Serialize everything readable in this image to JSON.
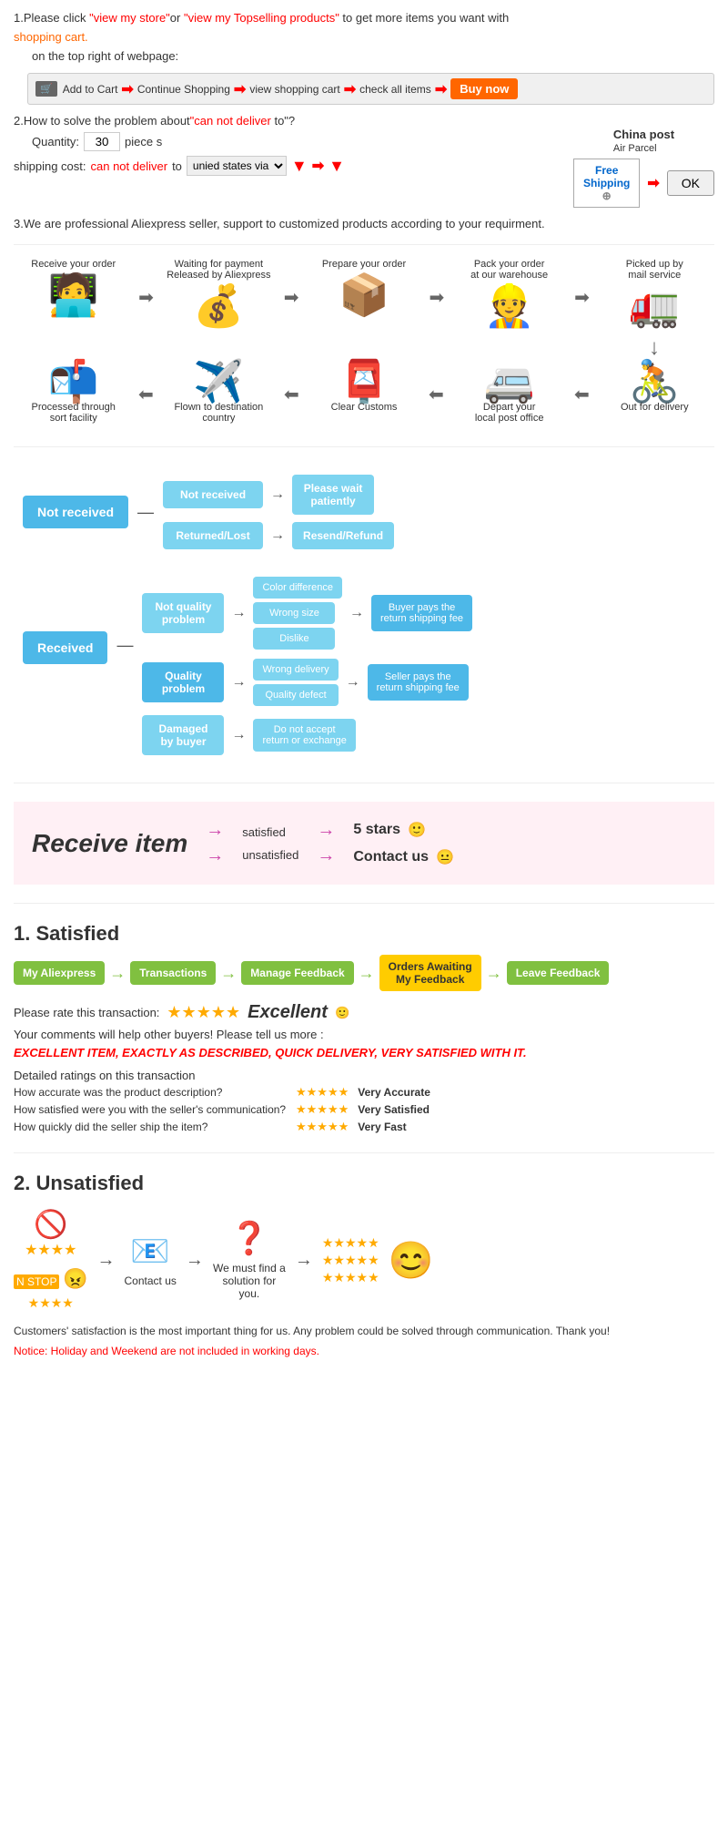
{
  "section1": {
    "text1": "1.Please click ",
    "link1": "\"view my store\"",
    "text2": "or ",
    "link2": "\"view my Topselling products\"",
    "text3": " to get more items you want with",
    "link3": "shopping cart.",
    "subtext": "on the top right of webpage:",
    "steps": [
      {
        "label": "Add to Cart",
        "icon": "🛒"
      },
      {
        "label": "Continue Shopping"
      },
      {
        "label": "view shopping cart"
      },
      {
        "label": "check all items"
      },
      {
        "label": "Buy now",
        "highlight": true
      }
    ]
  },
  "section2": {
    "title": "2.How to solve the problem about",
    "red1": "\"can not deliver",
    "text1": " to\"?",
    "qty_label": "Quantity:",
    "qty_value": "30",
    "qty_unit": "piece s",
    "ship_label": "shipping cost:",
    "ship_red": "can not deliver",
    "ship_text": " to ",
    "ship_select": "unied states via",
    "china_post": "China post",
    "air_parcel": "Air Parcel",
    "free_shipping": "Free\nShipping",
    "ok_label": "OK"
  },
  "section3": {
    "text": "3.We are professional Aliexpress seller, support to customized products according to your requirment."
  },
  "process": {
    "row1": [
      {
        "label": "Receive your order",
        "icon": "🧑‍💻"
      },
      {
        "label": "Waiting for payment\nReleased by Aliexpress",
        "icon": "💰"
      },
      {
        "label": "Prepare your order",
        "icon": "📦"
      },
      {
        "label": "Pack your order\nat our warehouse",
        "icon": "👷"
      },
      {
        "label": "Picked up by\nmail service",
        "icon": "🚛"
      }
    ],
    "row2": [
      {
        "label": "Out for delivery",
        "icon": "🚴"
      },
      {
        "label": "Depart your\nlocal post office",
        "icon": "🚐"
      },
      {
        "label": "Clear Customs",
        "icon": "📮"
      },
      {
        "label": "Flown to destination\ncountry",
        "icon": "✈️"
      },
      {
        "label": "Processed through\nsort facility",
        "icon": "📬"
      }
    ]
  },
  "flowchart": {
    "not_received_main": "Not received",
    "not_received1": "Not received",
    "not_received2": "Returned/Lost",
    "outcome1": "Please wait\npatiently",
    "outcome2": "Resend/Refund",
    "received_main": "Received",
    "no_quality": "Not quality\nproblem",
    "quality": "Quality\nproblem",
    "damaged": "Damaged\nby buyer",
    "color_diff": "Color difference",
    "wrong_size": "Wrong size",
    "dislike": "Dislike",
    "wrong_delivery": "Wrong delivery",
    "quality_defect": "Quality defect",
    "buyer_pays": "Buyer pays the\nreturn shipping fee",
    "seller_pays": "Seller pays the\nreturn shipping fee",
    "do_not_accept": "Do not accept\nreturn or exchange"
  },
  "receive_section": {
    "title": "Receive item",
    "satisfied": "satisfied",
    "unsatisfied": "unsatisfied",
    "result1": "5 stars",
    "result2": "Contact us",
    "emoji1": "🙂",
    "emoji2": "😐"
  },
  "satisfied": {
    "title": "1. Satisfied",
    "steps": [
      "My Aliexpress",
      "Transactions",
      "Manage Feedback",
      "Orders Awaiting\nMy Feedback",
      "Leave Feedback"
    ],
    "rate_text": "Please rate this transaction:",
    "excellent": "Excellent",
    "emoji": "🙂",
    "comments_text": "Your comments will help other buyers! Please tell us more :",
    "example_text": "EXCELLENT ITEM, EXACTLY AS DESCRIBED, QUICK DELIVERY, VERY SATISFIED WITH IT.",
    "detailed_title": "Detailed ratings on this transaction",
    "ratings": [
      {
        "label": "How accurate was the product description?",
        "value": "Very Accurate"
      },
      {
        "label": "How satisfied were you with the seller's communication?",
        "value": "Very Satisfied"
      },
      {
        "label": "How quickly did the seller ship the item?",
        "value": "Very Fast"
      }
    ]
  },
  "unsatisfied": {
    "title": "2. Unsatisfied",
    "steps": [
      {
        "icon": "🚫⭐",
        "type": "no-sign-stars"
      },
      {
        "icon": "😤",
        "type": "angry"
      },
      {
        "icon": "📧",
        "label": "Contact us"
      },
      {
        "icon": "❓",
        "label": "We must find\na solution for\nyou."
      },
      {
        "icon": "⭐⭐⭐⭐⭐",
        "type": "stars-result"
      }
    ],
    "footer": "Customers' satisfaction is the most important thing for us. Any problem could be solved through communication. Thank you!",
    "notice": "Notice: Holiday and Weekend are not included in working days."
  }
}
